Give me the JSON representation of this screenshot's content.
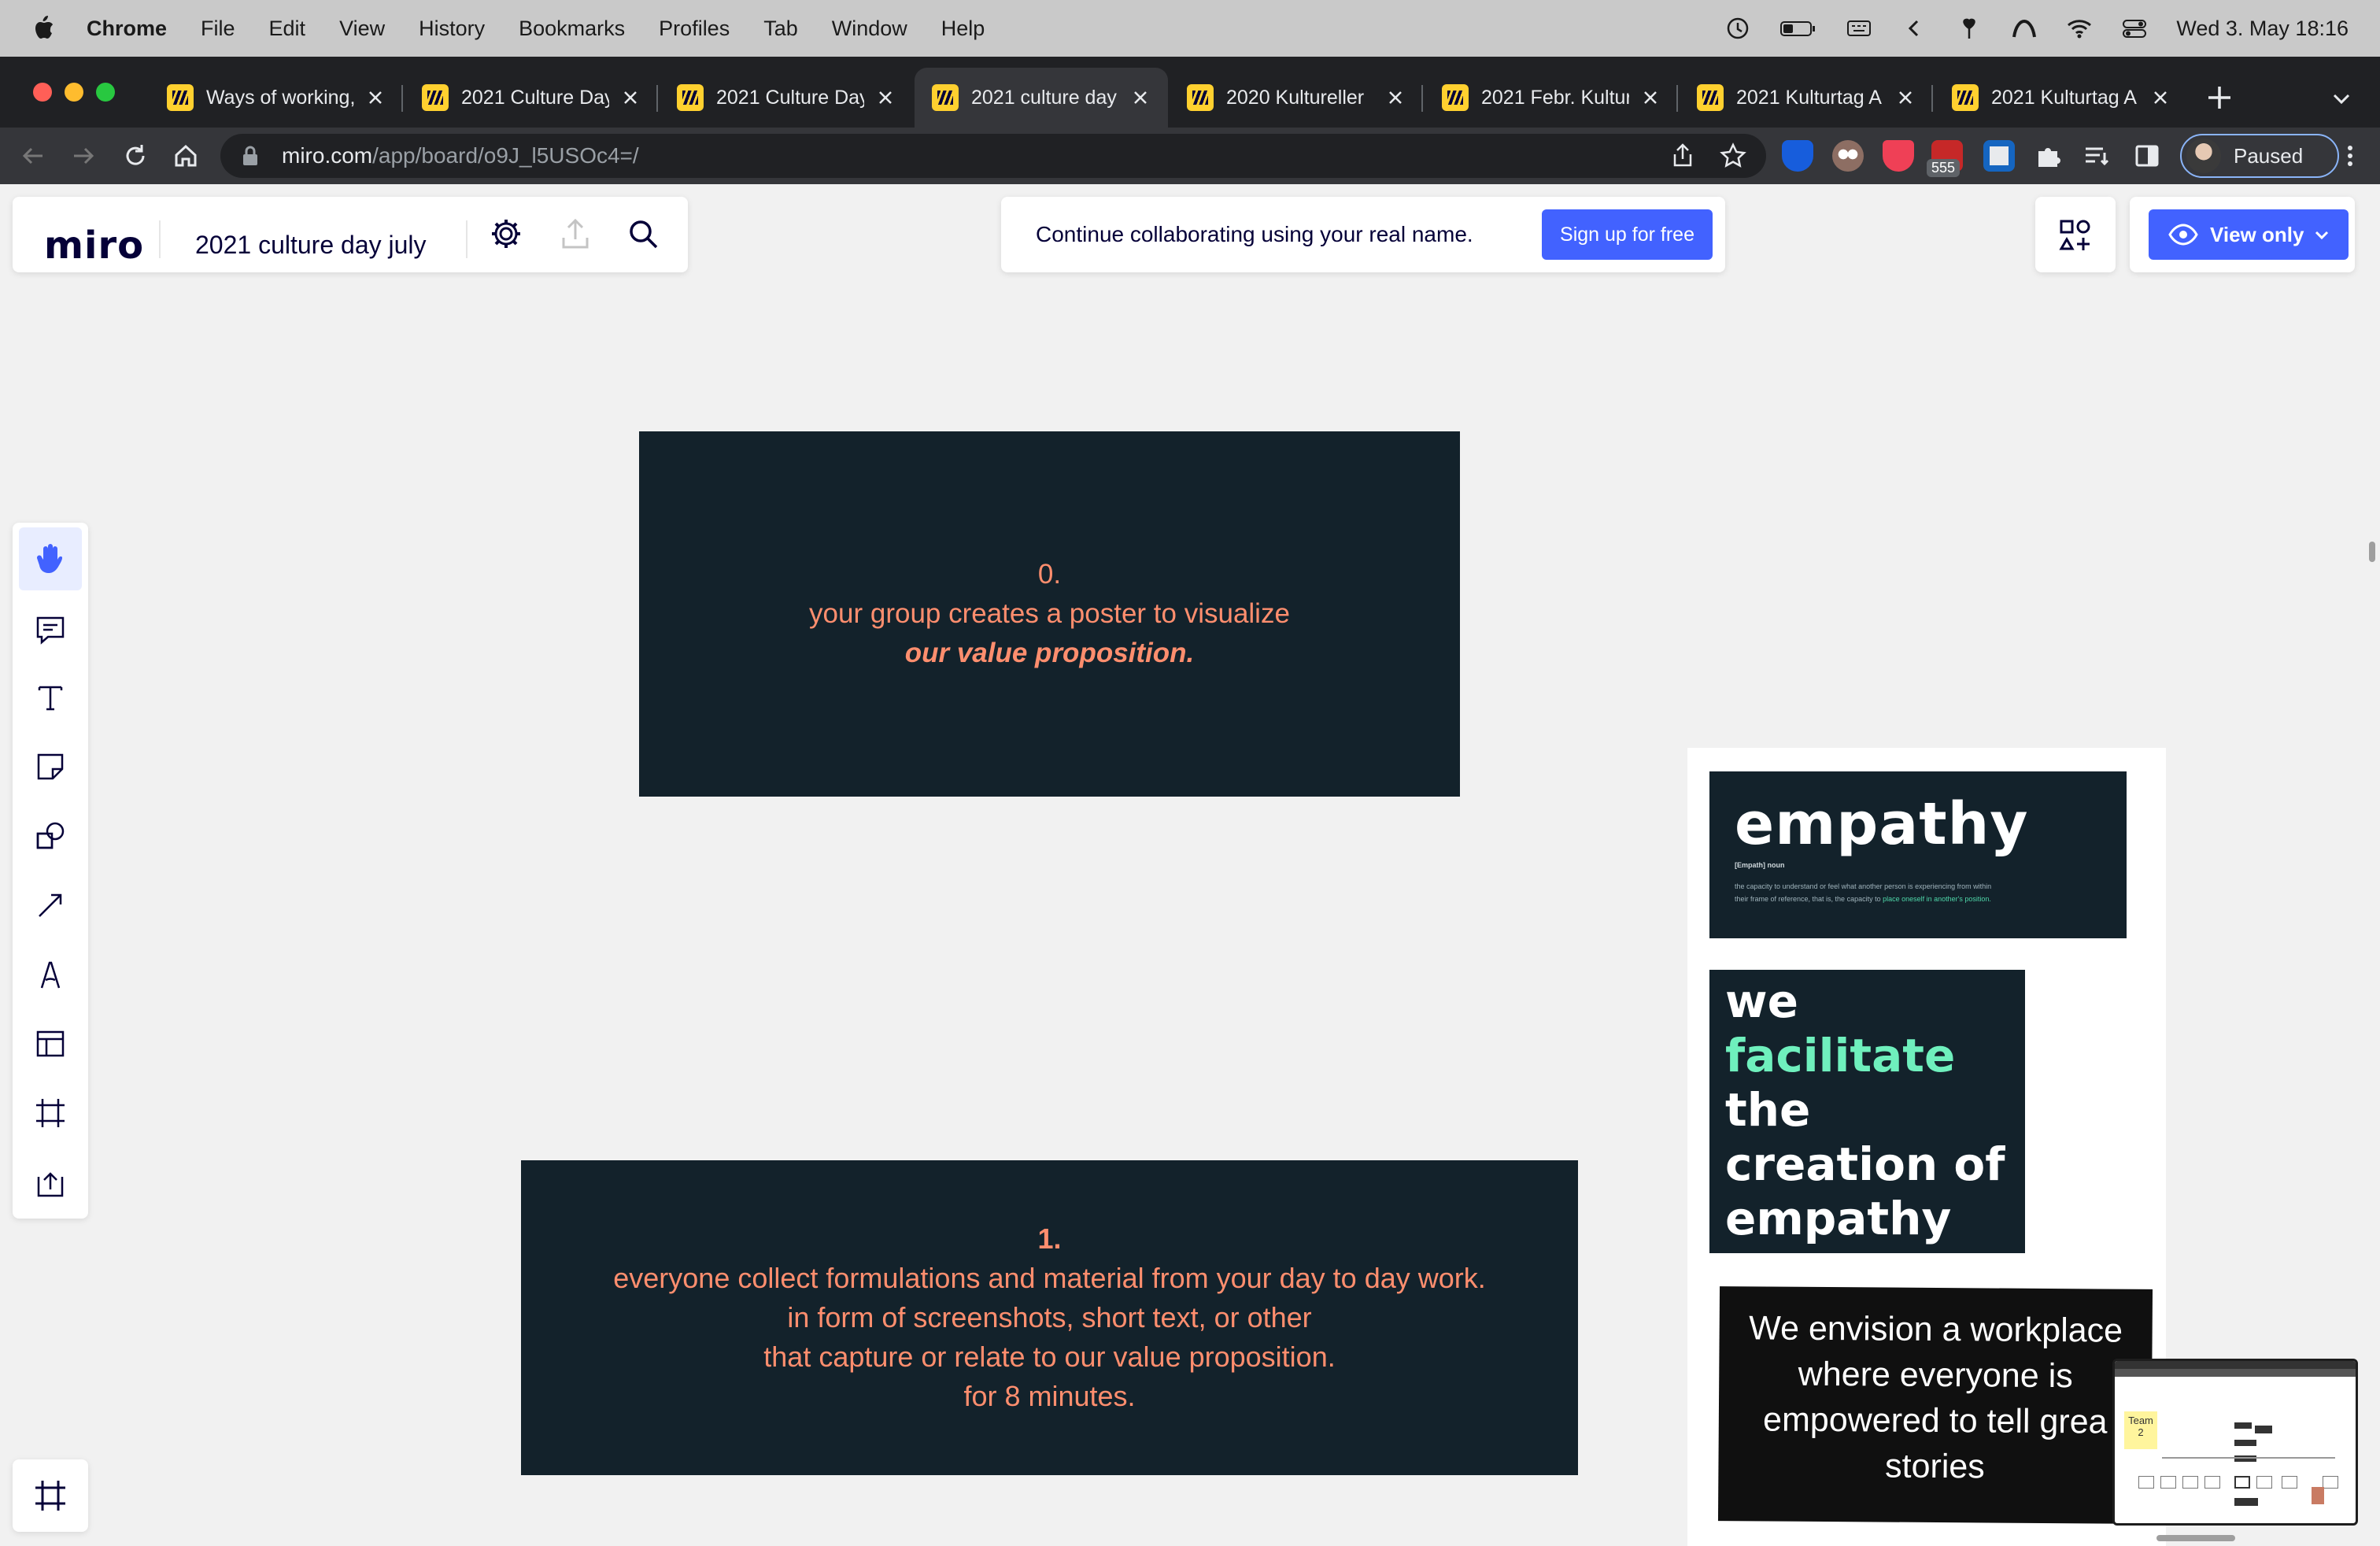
{
  "menubar": {
    "app": "Chrome",
    "items": [
      "File",
      "Edit",
      "View",
      "History",
      "Bookmarks",
      "Profiles",
      "Tab",
      "Window",
      "Help"
    ],
    "datetime": "Wed 3. May  18:16"
  },
  "tabs": [
    {
      "title": "Ways of working,",
      "active": false
    },
    {
      "title": "2021 Culture Day",
      "active": false
    },
    {
      "title": "2021 Culture Day",
      "active": false
    },
    {
      "title": "2021 culture day",
      "active": true
    },
    {
      "title": "2020 Kultureller",
      "active": false
    },
    {
      "title": "2021 Febr. Kultur",
      "active": false
    },
    {
      "title": "2021 Kulturtag A",
      "active": false
    },
    {
      "title": "2021 Kulturtag A",
      "active": false
    }
  ],
  "address": {
    "host": "miro.com",
    "path": "/app/board/o9J_l5USOc4=/"
  },
  "extensions": {
    "badge": "555"
  },
  "profile": {
    "label": "Paused"
  },
  "miro": {
    "logo": "miro",
    "board_name": "2021 culture day july",
    "signup_text": "Continue collaborating using your real name.",
    "signup_button": "Sign up for free",
    "view_only": "View only",
    "tools": [
      "hand-tool",
      "comment-tool",
      "text-tool",
      "sticky-note-tool",
      "shapes-tool",
      "arrow-tool",
      "pen-tool",
      "templates-tool",
      "frame-tool",
      "upload-tool"
    ]
  },
  "board": {
    "card1": {
      "line1": "0.",
      "line2": "your group creates a poster to visualize",
      "line3": "our value proposition."
    },
    "card2": {
      "line1": "1.",
      "line2": "everyone collect formulations and material from your day to day work.",
      "line3": "in form of screenshots, short text, or other",
      "line4": "that capture or relate to our value proposition.",
      "line5": "for 8 minutes."
    },
    "empathy": {
      "title": "empathy",
      "pos": "[Empath] noun",
      "def_a": "the capacity to understand or feel what another person is experiencing from within",
      "def_b": "their frame of reference, that is, the capacity to ",
      "def_c": "place oneself in another's position."
    },
    "facilitate": {
      "w1": "we",
      "w2": "facilitate",
      "w3": "the",
      "w4": "creation of",
      "w5": "empathy"
    },
    "envision": {
      "l1": "We envision a workplace",
      "l2": "where everyone is",
      "l3": "empowered to tell grea",
      "l4": "stories"
    },
    "minimap": {
      "team_label": "Team 2"
    }
  }
}
